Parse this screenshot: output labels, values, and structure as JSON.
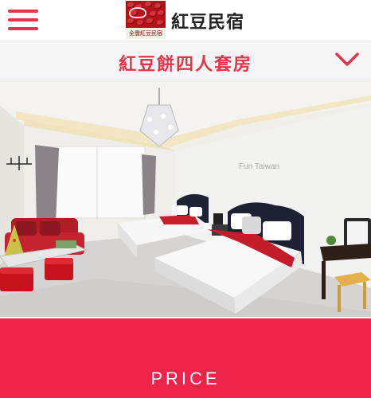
{
  "header": {
    "logo_text": "全豐紅豆民宿",
    "site_title": "紅豆民宿"
  },
  "room_selector": {
    "selected_room": "紅豆餅四人套房"
  },
  "photo": {
    "watermark": "Fun Taiwan"
  },
  "price": {
    "label": "PRICE"
  },
  "colors": {
    "accent": "#e5334a",
    "price_bar": "#f0244a"
  }
}
